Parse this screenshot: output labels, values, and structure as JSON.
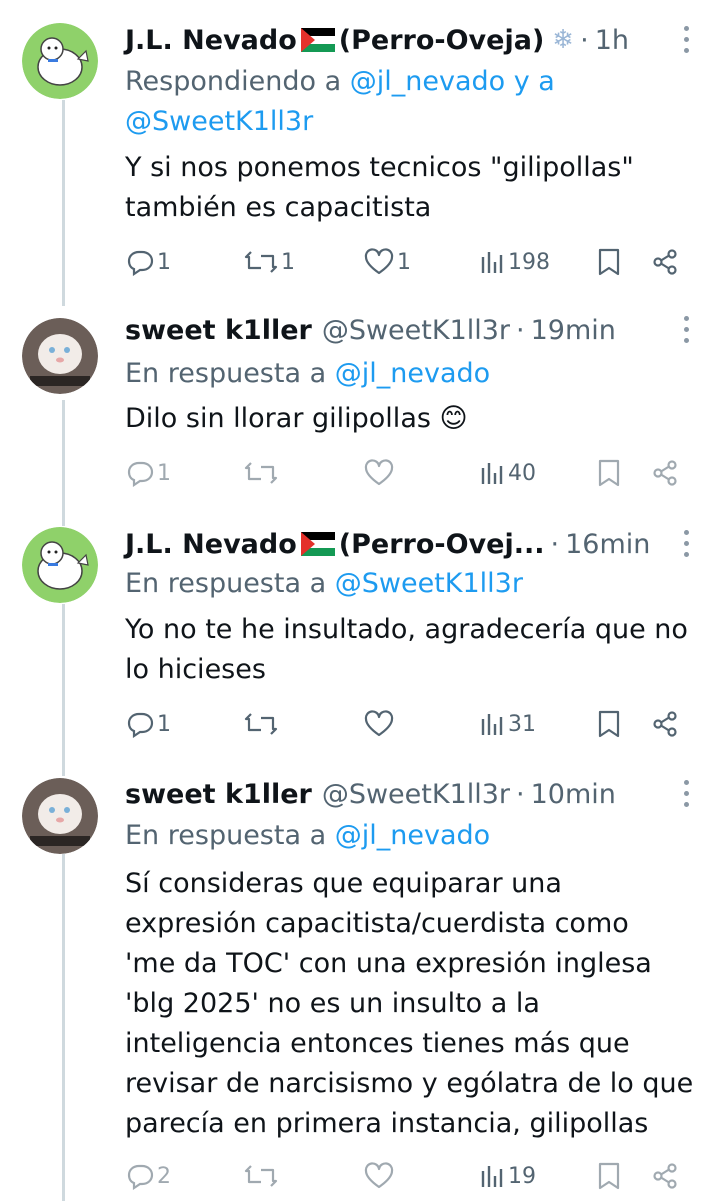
{
  "tweets": [
    {
      "name": "J.L. Nevado",
      "name_suffix": "(Perro-Oveja)",
      "handle": "",
      "time": "1h",
      "reply_prefix": "Respondiendo a",
      "reply_mentions": "@jl_nevado y a",
      "reply_mentions_2": "@SweetK1ll3r",
      "text_lines": [
        "Y si nos ponemos tecnicos \"gilipollas\"",
        "también es capacitista"
      ],
      "replies": "1",
      "retweets": "1",
      "likes": "1",
      "views": "198"
    },
    {
      "name": "sweet k1ller",
      "handle": "@SweetK1ll3r",
      "time": "19min",
      "reply_prefix": "En respuesta a",
      "reply_mentions": "@jl_nevado",
      "text_lines": [
        "Dilo sin llorar gilipollas 😊"
      ],
      "replies": "1",
      "retweets": "",
      "likes": "",
      "views": "40"
    },
    {
      "name": "J.L. Nevado",
      "name_suffix": "(Perro-Ovej...",
      "handle": "",
      "time": "16min",
      "reply_prefix": "En respuesta a",
      "reply_mentions": "@SweetK1ll3r",
      "text_lines": [
        "Yo no te he insultado, agradecería que no",
        "lo hicieses"
      ],
      "replies": "1",
      "retweets": "",
      "likes": "",
      "views": "31"
    },
    {
      "name": "sweet k1ller",
      "handle": "@SweetK1ll3r",
      "time": "10min",
      "reply_prefix": "En respuesta a",
      "reply_mentions": "@jl_nevado",
      "text_lines": [
        "Sí consideras que equiparar una",
        "expresión capacitista/cuerdista como",
        "'me da TOC' con una expresión inglesa",
        "'blg 2025' no es un insulto a la",
        "inteligencia entonces tienes más que",
        "revisar de narcisismo y ególatra de lo que",
        "parecía en primera instancia, gilipollas"
      ],
      "replies": "2",
      "retweets": "",
      "likes": "",
      "views": "19"
    }
  ],
  "icons": {
    "reply": "reply-icon",
    "retweet": "retweet-icon",
    "like": "heart-icon",
    "views": "views-icon",
    "bookmark": "bookmark-icon",
    "share": "share-icon",
    "flag": "palestine-flag-icon",
    "snow": "snowflake-icon"
  },
  "colors": {
    "mention": "#1d9bf0",
    "secondary": "#536471",
    "text": "#0f1419",
    "thread_line": "#cfd9de"
  }
}
